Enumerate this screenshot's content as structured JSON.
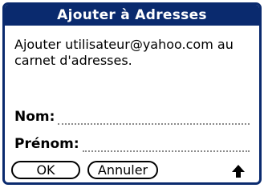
{
  "dialog": {
    "title": "Ajouter à Adresses",
    "message": "Ajouter utilisateur@yahoo.com au carnet d'adresses.",
    "fields": {
      "last_name_label": "Nom:",
      "last_name_value": "",
      "first_name_label": "Prénom:",
      "first_name_value": ""
    },
    "buttons": {
      "ok_label": "OK",
      "cancel_label": "Annuler"
    },
    "icons": {
      "shift_indicator": "up-arrow-icon"
    },
    "colors": {
      "title_bar": "#0a2a6e"
    }
  }
}
